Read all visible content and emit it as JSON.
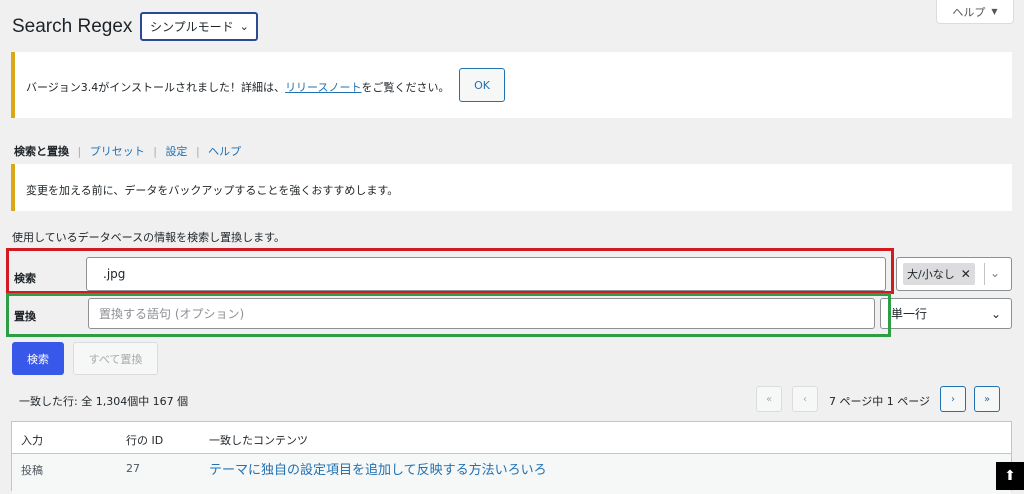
{
  "header": {
    "title": "Search Regex",
    "mode_select": "シンプルモード",
    "help_tab": "ヘルプ"
  },
  "notice_update": {
    "text_before": "バージョン3.4がインストールされました！詳細は、",
    "link": "リリースノート",
    "text_after": "をご覧ください。",
    "ok_button": "OK"
  },
  "subnav": {
    "items": [
      "検索と置換",
      "プリセット",
      "設定",
      "ヘルプ"
    ],
    "separator": "|"
  },
  "notice_backup": {
    "text": "変更を加える前に、データをバックアップすることを強くおすすめします。"
  },
  "intro": "使用しているデータベースの情報を検索し置換します。",
  "form": {
    "search_label": "検索",
    "search_value": ".jpg",
    "case_tag": "大/小なし",
    "replace_label": "置換",
    "replace_placeholder": "置換する語句 (オプション)",
    "line_mode": "単一行",
    "search_button": "検索",
    "replace_all_button": "すべて置換"
  },
  "results": {
    "match_count": "一致した行: 全 1,304個中 167 個",
    "pagination": {
      "first": "«",
      "prev": "‹",
      "info": "7 ページ中 1 ページ",
      "next": "›",
      "last": "»"
    },
    "columns": [
      "入力",
      "行の ID",
      "一致したコンテンツ"
    ],
    "rows": [
      {
        "type": "投稿",
        "id": "27",
        "content": "テーマに独自の設定項目を追加して反映する方法いろいろ"
      }
    ]
  },
  "colors": {
    "accent": "#2271b1",
    "primary_button": "#3858e9",
    "highlight_red": "#d11a22",
    "highlight_green": "#2e9e44",
    "notice_border": "#dba617"
  }
}
